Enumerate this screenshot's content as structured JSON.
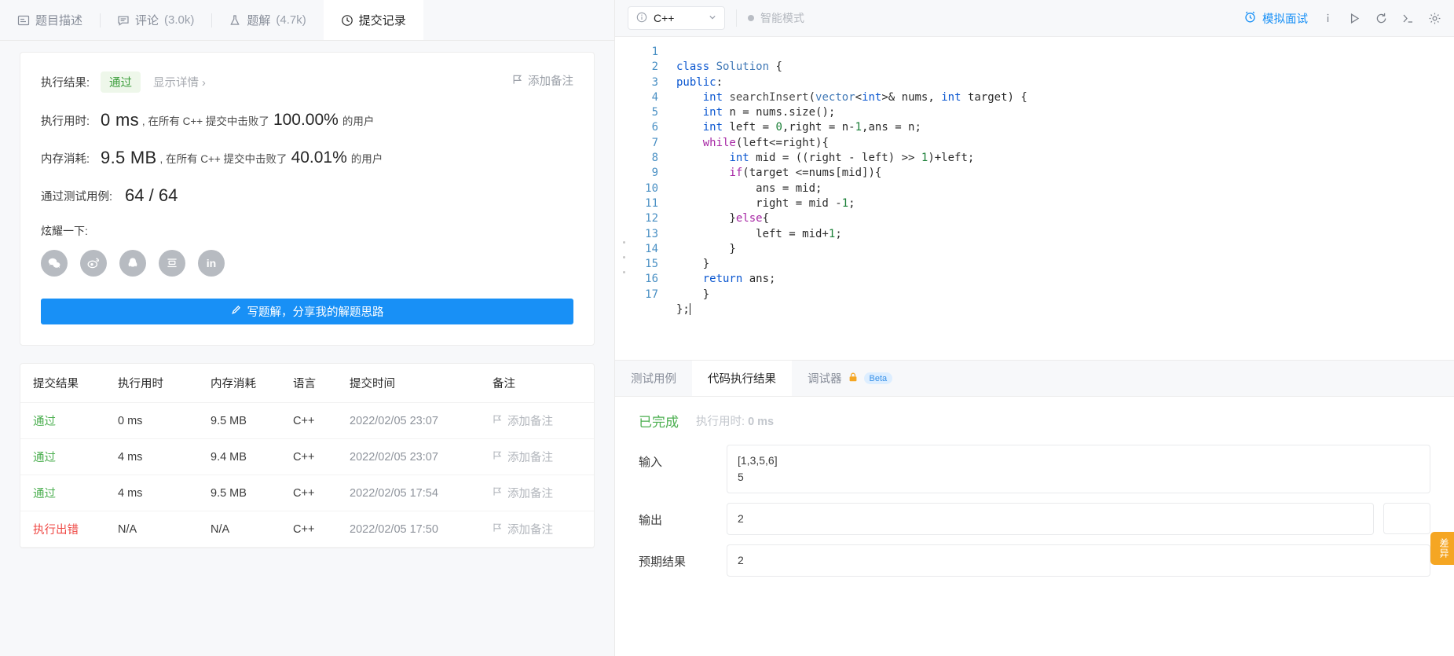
{
  "left": {
    "tabs": [
      {
        "label": "题目描述",
        "count": "",
        "icon": "description-icon",
        "active": false
      },
      {
        "label": "评论",
        "count": "(3.0k)",
        "icon": "comment-icon",
        "active": false
      },
      {
        "label": "题解",
        "count": "(4.7k)",
        "icon": "flask-icon",
        "active": false
      },
      {
        "label": "提交记录",
        "count": "",
        "icon": "clock-icon",
        "active": true
      }
    ],
    "result": {
      "result_label": "执行结果:",
      "status": "通过",
      "detail_link": "显示详情 ›",
      "add_note": "添加备注",
      "runtime_label": "执行用时:",
      "runtime_value": "0 ms",
      "runtime_mid": ", 在所有 C++ 提交中击败了",
      "runtime_pct": "100.00%",
      "runtime_suffix": "的用户",
      "memory_label": "内存消耗:",
      "memory_value": "9.5 MB",
      "memory_mid": ", 在所有 C++ 提交中击败了",
      "memory_pct": "40.01%",
      "memory_suffix": "的用户",
      "cases_label": "通过测试用例:",
      "cases_value": "64 / 64",
      "brag_label": "炫耀一下:",
      "socials": [
        "wechat-icon",
        "weibo-icon",
        "qq-icon",
        "douban-icon",
        "linkedin-icon"
      ],
      "write_button": "写题解，分享我的解题思路"
    },
    "table": {
      "headers": [
        "提交结果",
        "执行用时",
        "内存消耗",
        "语言",
        "提交时间",
        "备注"
      ],
      "rows": [
        {
          "status": "通过",
          "state": "ok",
          "runtime": "0 ms",
          "memory": "9.5 MB",
          "lang": "C++",
          "time": "2022/02/05 23:07",
          "note": "添加备注"
        },
        {
          "status": "通过",
          "state": "ok",
          "runtime": "4 ms",
          "memory": "9.4 MB",
          "lang": "C++",
          "time": "2022/02/05 23:07",
          "note": "添加备注"
        },
        {
          "status": "通过",
          "state": "ok",
          "runtime": "4 ms",
          "memory": "9.5 MB",
          "lang": "C++",
          "time": "2022/02/05 17:54",
          "note": "添加备注"
        },
        {
          "status": "执行出错",
          "state": "err",
          "runtime": "N/A",
          "memory": "N/A",
          "lang": "C++",
          "time": "2022/02/05 17:50",
          "note": "添加备注"
        }
      ]
    }
  },
  "editor": {
    "language": "C++",
    "smart_mode": "智能模式",
    "mock_interview": "模拟面试",
    "toolbar_icons": [
      "info-icon",
      "run-icon",
      "reset-icon",
      "console-icon",
      "settings-icon"
    ],
    "line_count": 17,
    "code_lines": [
      "class Solution {",
      "public:",
      "    int searchInsert(vector<int>& nums, int target) {",
      "    int n = nums.size();",
      "    int left = 0,right = n-1,ans = n;",
      "    while(left<=right){",
      "        int mid = ((right - left) >> 1)+left;",
      "        if(target <=nums[mid]){",
      "            ans = mid;",
      "            right = mid -1;",
      "        }else{",
      "            left = mid+1;",
      "        }",
      "    }",
      "    return ans;",
      "    }",
      "};"
    ]
  },
  "console": {
    "tabs": [
      {
        "label": "测试用例",
        "active": false,
        "badge": ""
      },
      {
        "label": "代码执行结果",
        "active": true,
        "badge": ""
      },
      {
        "label": "调试器",
        "active": false,
        "badge": "Beta",
        "icon": "lock-icon"
      }
    ],
    "status": "已完成",
    "runtime_label": "执行用时:",
    "runtime_value": "0 ms",
    "input_label": "输入",
    "input_value": "[1,3,5,6]\n5",
    "output_label": "输出",
    "output_value": "2",
    "expected_label": "预期结果",
    "expected_value": "2",
    "diff_button": "差异"
  },
  "colors": {
    "accent": "#1890f6",
    "pass": "#4caf50",
    "error": "#ef4743",
    "warn": "#f5a623"
  }
}
